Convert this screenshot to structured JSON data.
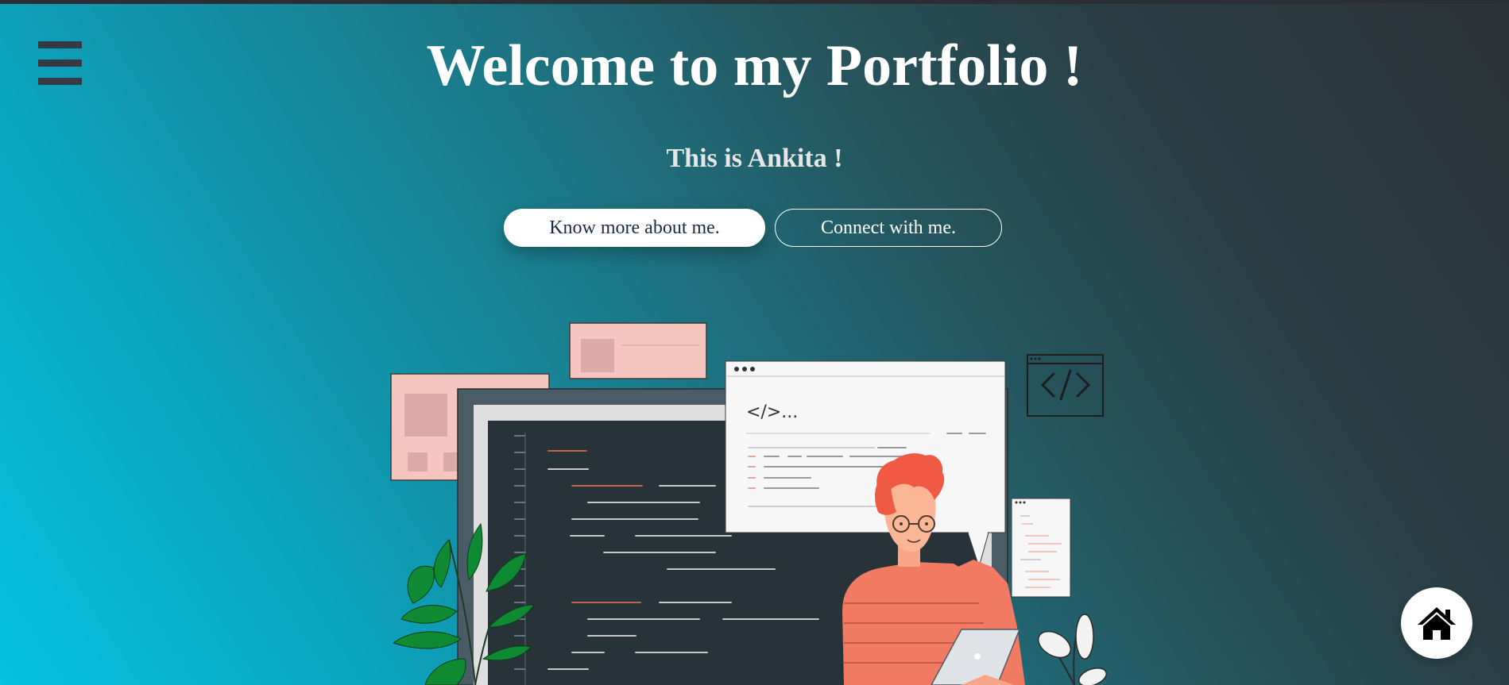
{
  "header": {
    "title": "Welcome to my Portfolio !",
    "subtitle": "This is Ankita !"
  },
  "menu": {
    "icon": "hamburger-menu-icon"
  },
  "buttons": {
    "primary_label": "Know more about me.",
    "secondary_label": "Connect with me."
  },
  "illustration": {
    "editor_snippet": "</>...",
    "icons": [
      "code-window-icon",
      "plant-icon",
      "laptop-icon"
    ]
  },
  "home": {
    "icon": "home-icon"
  },
  "colors": {
    "title": "#ffffff",
    "button_text": "#1c2b45",
    "menu_icon": "#353a45",
    "person_shirt": "#f07a62",
    "card_pink": "#f5c5bf"
  }
}
